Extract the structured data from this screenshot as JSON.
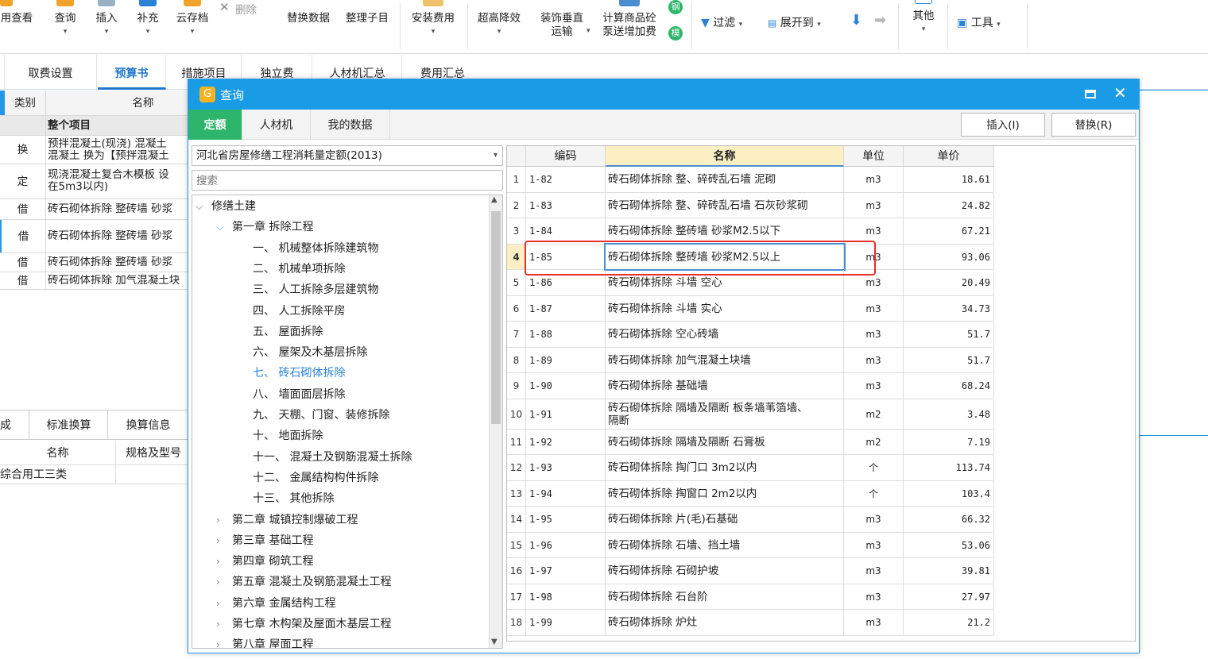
{
  "ribbon": {
    "buttons": [
      {
        "label": "用查看",
        "dd": ""
      },
      {
        "label": "查询",
        "dd": "▾"
      },
      {
        "label": "插入",
        "dd": "▾"
      },
      {
        "label": "补充",
        "dd": "▾"
      },
      {
        "label": "云存档",
        "dd": "▾"
      },
      {
        "label": "删除",
        "dd": ""
      },
      {
        "label": "替换数据",
        "dd": ""
      },
      {
        "label": "整理子目",
        "dd": ""
      },
      {
        "label": "安装费用",
        "dd": "▾"
      },
      {
        "label": "超高降效",
        "dd": "▾"
      },
      {
        "label": "装饰垂直",
        "label2": "运输",
        "dd": "▾"
      },
      {
        "label": "计算商品砼",
        "label2": "泵送增加费",
        "dd": ""
      },
      {
        "label": "过滤",
        "dd": "▾"
      },
      {
        "label": "展开到",
        "dd": "▾"
      },
      {
        "label": "其他",
        "dd": "▾"
      },
      {
        "label": "工具",
        "dd": "▾"
      }
    ],
    "badge1": "钢",
    "badge2": "模"
  },
  "tabs": [
    "取费设置",
    "预算书",
    "措施项目",
    "独立费",
    "人材机汇总",
    "费用汇总"
  ],
  "left_table": {
    "header": {
      "type": "类别",
      "name": "名称"
    },
    "rows": [
      {
        "type": "",
        "name": "整个项目"
      },
      {
        "type": "换",
        "name": "预拌混凝土(现浇) 混凝土",
        "name2": "混凝土  换为【预拌混凝土"
      },
      {
        "type": "定",
        "name": "现浇混凝土复合木模板 设",
        "name2": "在5m3以内)"
      },
      {
        "type": "借",
        "name": "砖石砌体拆除 整砖墙 砂浆"
      },
      {
        "type": "借",
        "name": "砖石砌体拆除 整砖墙 砂浆"
      },
      {
        "type": "借",
        "name": "砖石砌体拆除 整砖墙 砂浆"
      },
      {
        "type": "借",
        "name": "砖石砌体拆除 加气混凝土块"
      }
    ]
  },
  "lower": {
    "tabs": [
      "成",
      "标准换算",
      "换算信息"
    ],
    "headers": [
      "名称",
      "规格及型号"
    ],
    "row": "综合用工三类"
  },
  "dialog": {
    "title": "查询",
    "tabs": [
      "定额",
      "人材机",
      "我的数据"
    ],
    "insert_btn": "插入(I)",
    "replace_btn": "替换(R)",
    "library": "河北省房屋修缮工程消耗量定额(2013)",
    "search_placeholder": "搜索",
    "tree": [
      {
        "label": "修缮土建",
        "level": 0,
        "arrow": "⌵"
      },
      {
        "label": "第一章 拆除工程",
        "level": 1,
        "arrow": "⌵"
      },
      {
        "label": "一、 机械整体拆除建筑物",
        "level": 2,
        "arrow": ""
      },
      {
        "label": "二、 机械单项拆除",
        "level": 2,
        "arrow": ""
      },
      {
        "label": "三、 人工拆除多层建筑物",
        "level": 2,
        "arrow": ""
      },
      {
        "label": "四、 人工拆除平房",
        "level": 2,
        "arrow": ""
      },
      {
        "label": "五、 屋面拆除",
        "level": 2,
        "arrow": ""
      },
      {
        "label": "六、 屋架及木基层拆除",
        "level": 2,
        "arrow": ""
      },
      {
        "label": "七、 砖石砌体拆除",
        "level": 2,
        "arrow": "",
        "selected": true
      },
      {
        "label": "八、 墙面面层拆除",
        "level": 2,
        "arrow": ""
      },
      {
        "label": "九、 天棚、门窗、装修拆除",
        "level": 2,
        "arrow": ""
      },
      {
        "label": "十、 地面拆除",
        "level": 2,
        "arrow": ""
      },
      {
        "label": "十一、 混凝土及钢筋混凝土拆除",
        "level": 2,
        "arrow": ""
      },
      {
        "label": "十二、 金属结构构件拆除",
        "level": 2,
        "arrow": ""
      },
      {
        "label": "十三、 其他拆除",
        "level": 2,
        "arrow": ""
      },
      {
        "label": "第二章 城镇控制爆破工程",
        "level": 1,
        "arrow": "›"
      },
      {
        "label": "第三章 基础工程",
        "level": 1,
        "arrow": "›"
      },
      {
        "label": "第四章 砌筑工程",
        "level": 1,
        "arrow": "›"
      },
      {
        "label": "第五章 混凝土及钢筋混凝土工程",
        "level": 1,
        "arrow": "›"
      },
      {
        "label": "第六章 金属结构工程",
        "level": 1,
        "arrow": "›"
      },
      {
        "label": "第七章 木构架及屋面木基层工程",
        "level": 1,
        "arrow": "›"
      },
      {
        "label": "第八章 屋面工程",
        "level": 1,
        "arrow": "›"
      }
    ],
    "grid": {
      "headers": {
        "code": "编码",
        "name": "名称",
        "unit": "单位",
        "price": "单价"
      },
      "rows": [
        {
          "num": "1",
          "code": "1-82",
          "name": "砖石砌体拆除 整、碎砖乱石墙 泥砌",
          "unit": "m3",
          "price": "18.61"
        },
        {
          "num": "2",
          "code": "1-83",
          "name": "砖石砌体拆除 整、碎砖乱石墙 石灰砂浆砌",
          "unit": "m3",
          "price": "24.82"
        },
        {
          "num": "3",
          "code": "1-84",
          "name": "砖石砌体拆除 整砖墙 砂浆M2.5以下",
          "unit": "m3",
          "price": "67.21"
        },
        {
          "num": "4",
          "code": "1-85",
          "name": "砖石砌体拆除 整砖墙 砂浆M2.5以上",
          "unit": "m3",
          "price": "93.06",
          "selected": true
        },
        {
          "num": "5",
          "code": "1-86",
          "name": "砖石砌体拆除 斗墙 空心",
          "unit": "m3",
          "price": "20.49"
        },
        {
          "num": "6",
          "code": "1-87",
          "name": "砖石砌体拆除 斗墙 实心",
          "unit": "m3",
          "price": "34.73"
        },
        {
          "num": "7",
          "code": "1-88",
          "name": "砖石砌体拆除 空心砖墙",
          "unit": "m3",
          "price": "51.7"
        },
        {
          "num": "8",
          "code": "1-89",
          "name": "砖石砌体拆除 加气混凝土块墙",
          "unit": "m3",
          "price": "51.7"
        },
        {
          "num": "9",
          "code": "1-90",
          "name": "砖石砌体拆除 基础墙",
          "unit": "m3",
          "price": "68.24"
        },
        {
          "num": "10",
          "code": "1-91",
          "name": "砖石砌体拆除 隔墙及隔断 板条墙苇箔墙、",
          "name2": "隔断",
          "unit": "m2",
          "price": "3.48"
        },
        {
          "num": "11",
          "code": "1-92",
          "name": "砖石砌体拆除 隔墙及隔断 石膏板",
          "unit": "m2",
          "price": "7.19"
        },
        {
          "num": "12",
          "code": "1-93",
          "name": "砖石砌体拆除 掏门口 3m2以内",
          "unit": "个",
          "price": "113.74"
        },
        {
          "num": "13",
          "code": "1-94",
          "name": "砖石砌体拆除 掏窗口 2m2以内",
          "unit": "个",
          "price": "103.4"
        },
        {
          "num": "14",
          "code": "1-95",
          "name": "砖石砌体拆除 片(毛)石基础",
          "unit": "m3",
          "price": "66.32"
        },
        {
          "num": "15",
          "code": "1-96",
          "name": "砖石砌体拆除 石墙、挡土墙",
          "unit": "m3",
          "price": "53.06"
        },
        {
          "num": "16",
          "code": "1-97",
          "name": "砖石砌体拆除 石砌护坡",
          "unit": "m3",
          "price": "39.81"
        },
        {
          "num": "17",
          "code": "1-98",
          "name": "砖石砌体拆除 石台阶",
          "unit": "m3",
          "price": "27.97"
        },
        {
          "num": "18",
          "code": "1-99",
          "name": "砖石砌体拆除 炉灶",
          "unit": "m3",
          "price": "21.2"
        }
      ]
    }
  },
  "colors": {
    "accent": "#1a9be6",
    "tab_green": "#2db66b",
    "highlight": "#e5302a",
    "active_tab": "#2277cc"
  }
}
